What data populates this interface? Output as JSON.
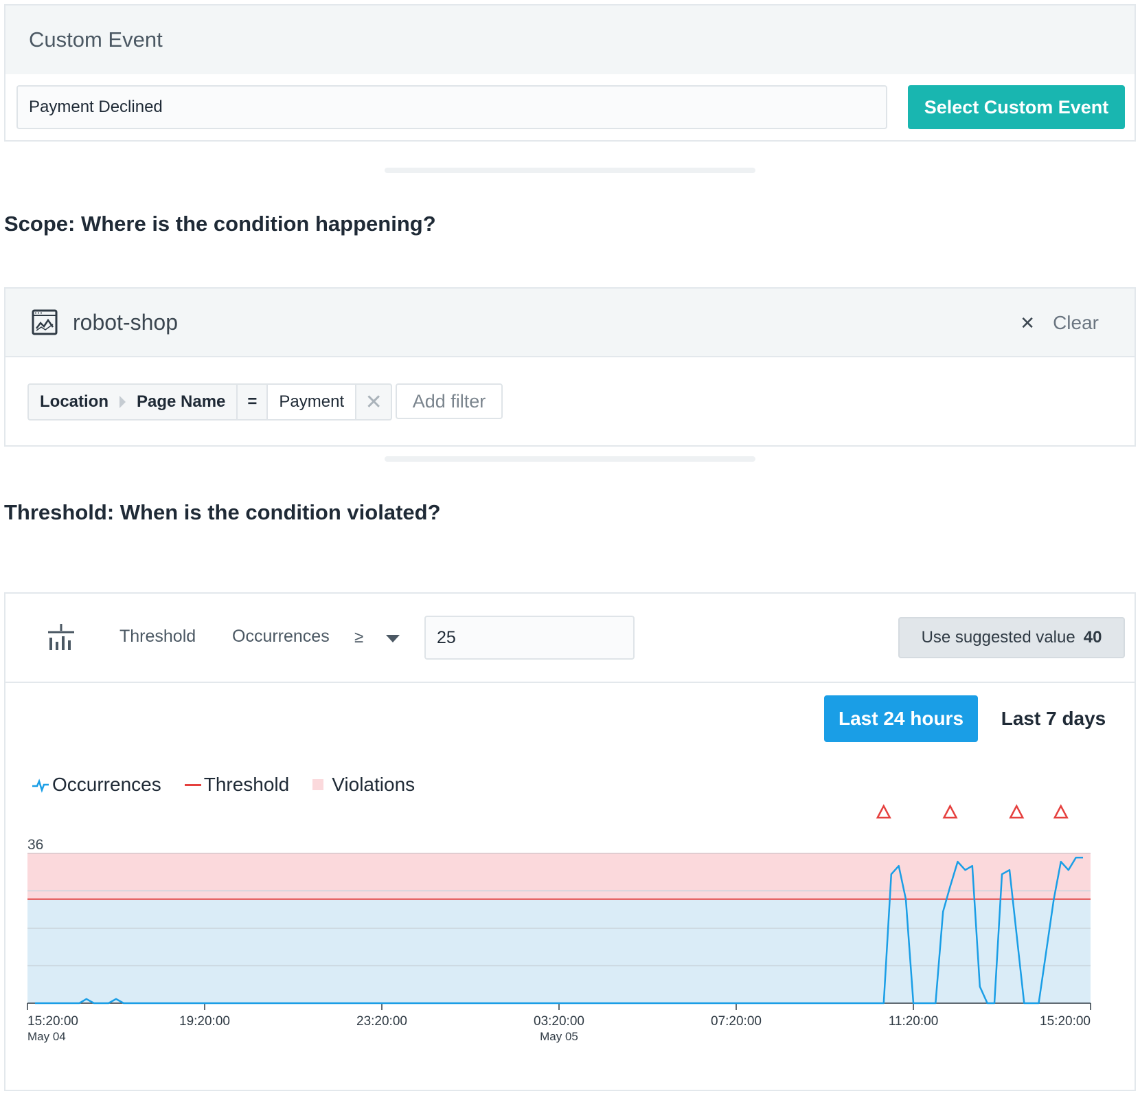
{
  "custom_event": {
    "title": "Custom Event",
    "value": "Payment Declined",
    "button_label": "Select Custom Event"
  },
  "scope": {
    "heading": "Scope: Where is the condition happening?",
    "app_name": "robot-shop",
    "clear_label": "Clear",
    "filter": {
      "path_1": "Location",
      "path_2": "Page Name",
      "operator": "=",
      "value": "Payment"
    },
    "add_filter_label": "Add filter"
  },
  "threshold": {
    "heading": "Threshold: When is the condition violated?",
    "label": "Threshold",
    "metric": "Occurrences",
    "operator": "≥",
    "value": "25",
    "suggest_label": "Use suggested value",
    "suggest_value": "40",
    "range_active": "Last 24 hours",
    "range_other": "Last 7 days"
  },
  "colors": {
    "accent_teal": "#19b6b0",
    "accent_blue": "#1a9ee6",
    "occurrences": "#1a9ee6",
    "threshold": "#e5403e",
    "violations": "#fbd9dc"
  },
  "chart_data": {
    "type": "line",
    "legend": [
      "Occurrences",
      "Threshold",
      "Violations"
    ],
    "ylim": [
      0,
      36
    ],
    "y_max_label": "36",
    "threshold": 25,
    "grid": true,
    "x_ticks": [
      {
        "t": 0,
        "label": "15:20:00",
        "sub": "May 04"
      },
      {
        "t": 4,
        "label": "19:20:00",
        "sub": ""
      },
      {
        "t": 8,
        "label": "23:20:00",
        "sub": ""
      },
      {
        "t": 12,
        "label": "03:20:00",
        "sub": "May 05"
      },
      {
        "t": 16,
        "label": "07:20:00",
        "sub": ""
      },
      {
        "t": 20,
        "label": "11:20:00",
        "sub": ""
      },
      {
        "t": 24,
        "label": "15:20:00",
        "sub": ""
      }
    ],
    "series": [
      {
        "name": "Occurrences",
        "x": [
          0.17,
          1.17,
          1.33,
          1.5,
          1.83,
          2.0,
          2.17,
          19.33,
          19.5,
          19.67,
          19.83,
          20.0,
          20.5,
          20.67,
          20.83,
          21.0,
          21.17,
          21.33,
          21.5,
          21.67,
          21.83,
          22.0,
          22.17,
          22.5,
          22.67,
          22.83,
          23.17,
          23.33,
          23.5,
          23.67,
          23.83
        ],
        "values": [
          0,
          0,
          1,
          0,
          0,
          1,
          0,
          0,
          31,
          33,
          25,
          0,
          0,
          22,
          28,
          34,
          32,
          33,
          4,
          0,
          0,
          31,
          32,
          0,
          0,
          0,
          25,
          34,
          32,
          35,
          35
        ]
      }
    ],
    "violation_markers_x": [
      19.33,
      20.83,
      22.33,
      23.33
    ]
  }
}
